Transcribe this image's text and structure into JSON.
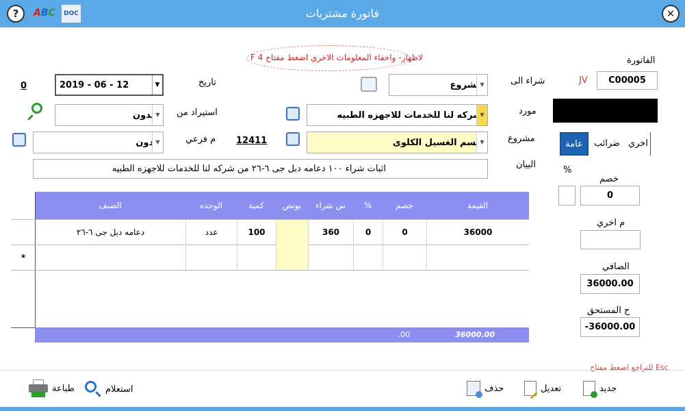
{
  "window": {
    "title": "فاتورة مشتريات"
  },
  "toggle_hint": "لاظهار- واخفاء المعلومات الاخري اضغط مفتاح F 4",
  "invoice": {
    "label": "الفاتورة",
    "code": "JV",
    "number": "C00005"
  },
  "buy_to": {
    "label": "شراء الى",
    "value": "مشروع"
  },
  "date": {
    "label": "تاريخ",
    "value": "2019 - 06 - 12",
    "zero": "0"
  },
  "supplier": {
    "label": "مورد",
    "value": "شركه لنا للخدمات للاجهزه الطبيه"
  },
  "import_from": {
    "label": "استيراد من",
    "value": "بـدون"
  },
  "project": {
    "label": "مشروع",
    "value": "قسم الغسيل الكلوى"
  },
  "branch": {
    "label": "م فرعي",
    "value": "12411",
    "select_value": "بدون"
  },
  "statement": {
    "label": "البيان",
    "value": "اثبات شراء ١٠٠ دعامه دبل جى ٦-٢٦ من شركه لنا للخدمات للاجهزه الطبيه"
  },
  "tabs": {
    "other": "اخري",
    "taxes": "ضرائب",
    "general": "عامة"
  },
  "summary": {
    "percent_label": "%",
    "discount_label": "خصم",
    "discount_value": "0",
    "other_label": "م اخري",
    "other_value": "",
    "net_label": "الصافي",
    "net_value": "36000.00",
    "due_label": "ح  المستحق",
    "due_value": "-36000.00"
  },
  "grid": {
    "headers": {
      "value": "القيمة",
      "discount": "خصم",
      "percent": "%",
      "price": "س شراء",
      "bonus": "بونص",
      "qty": "كمية",
      "unit": "الوحده",
      "item": "الصنف"
    },
    "rows": [
      {
        "value": "36000",
        "discount": "0",
        "percent": "0",
        "price": "360",
        "bonus": "",
        "qty": "100",
        "unit": "عدد",
        "item": "دعامه دبل جى ٦-٢٦"
      }
    ],
    "new_row_marker": "*",
    "footer": {
      "total": "36000.00",
      "discount_total": ".00"
    }
  },
  "esc_hint": "للتراجع اضغط مفتاح Esc",
  "actions": {
    "new": "جديد",
    "edit": "تعديل",
    "delete": "حذف",
    "query": "استعلام",
    "print": "طباعة"
  },
  "colors": {
    "titlebar": "#5aa9e6",
    "grid_header": "#8d8ff0",
    "hint_red": "#e02020",
    "active_tab": "#1e63b0"
  }
}
